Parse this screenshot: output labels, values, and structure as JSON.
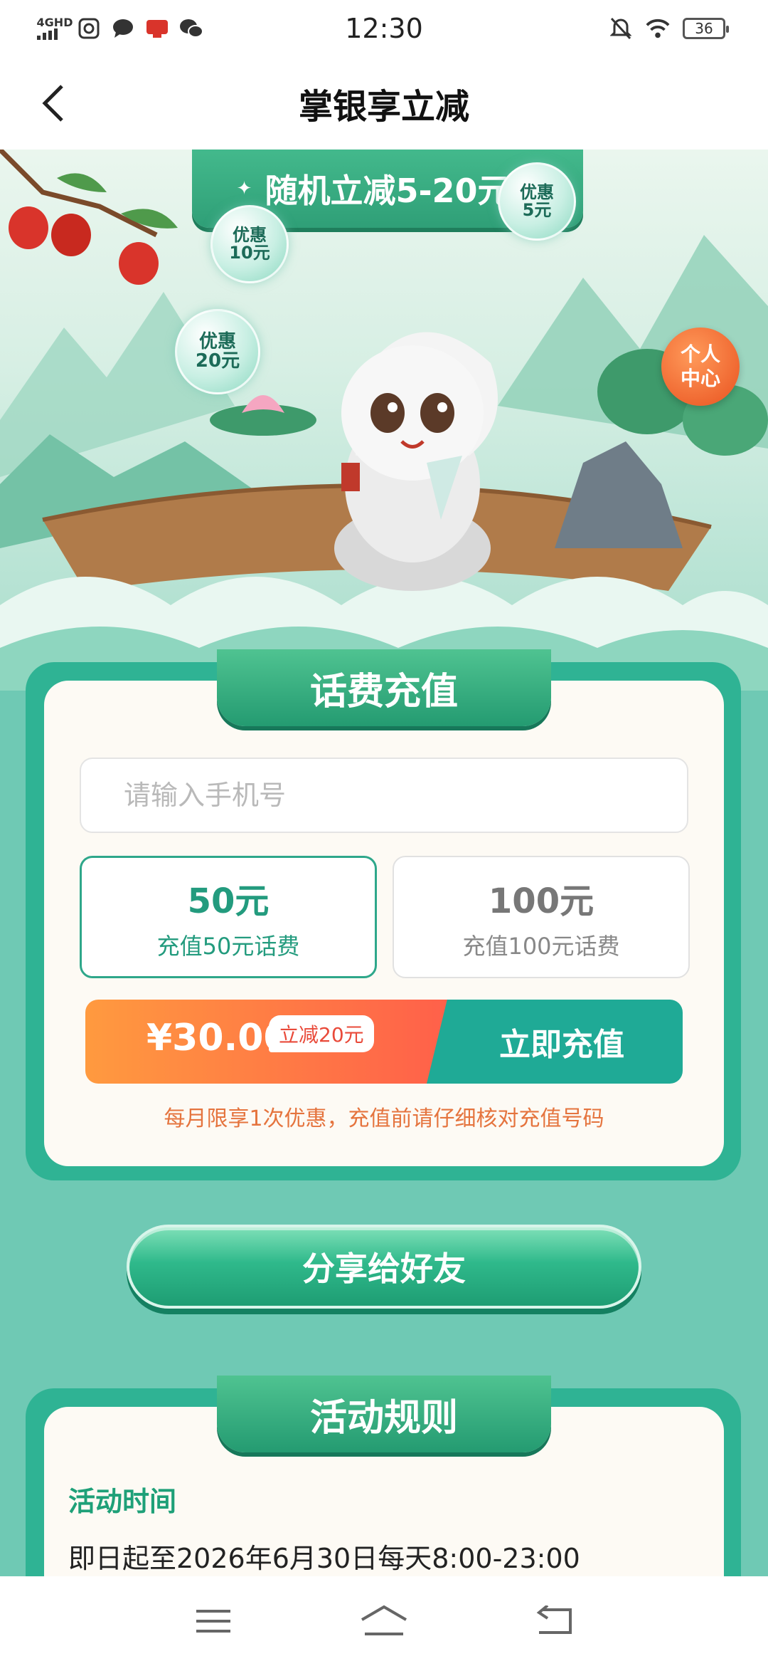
{
  "status_bar": {
    "time": "12:30",
    "signal_label": "4GHD",
    "battery": "36"
  },
  "nav": {
    "title": "掌银享立减"
  },
  "hero": {
    "ribbon_text": "随机立减5-20元",
    "bubbles": [
      {
        "line1": "优惠",
        "line2": "10元"
      },
      {
        "line1": "优惠",
        "line2": "5元"
      },
      {
        "line1": "优惠",
        "line2": "20元"
      }
    ],
    "personal_center": {
      "line1": "个人",
      "line2": "中心"
    }
  },
  "recharge": {
    "title": "话费充值",
    "phone_placeholder": "请输入手机号",
    "phone_value": "",
    "options": [
      {
        "amount": "50元",
        "desc": "充值50元话费",
        "selected": true
      },
      {
        "amount": "100元",
        "desc": "充值100元话费",
        "selected": false
      }
    ],
    "price": "¥30.00",
    "discount_badge": "立减20元",
    "pay_button": "立即充值",
    "notice": "每月限享1次优惠，充值前请仔细核对充值号码"
  },
  "share_button": "分享给好友",
  "rules": {
    "title": "活动规则",
    "heading": "活动时间",
    "time_text": "即日起至2026年6月30日每天8:00-23:00"
  },
  "colors": {
    "background": "#6fc9b4",
    "accent_green": "#2fb394",
    "pay_orange": "#ff7a45",
    "pay_teal": "#1faa96",
    "notice_orange": "#e5743e"
  }
}
